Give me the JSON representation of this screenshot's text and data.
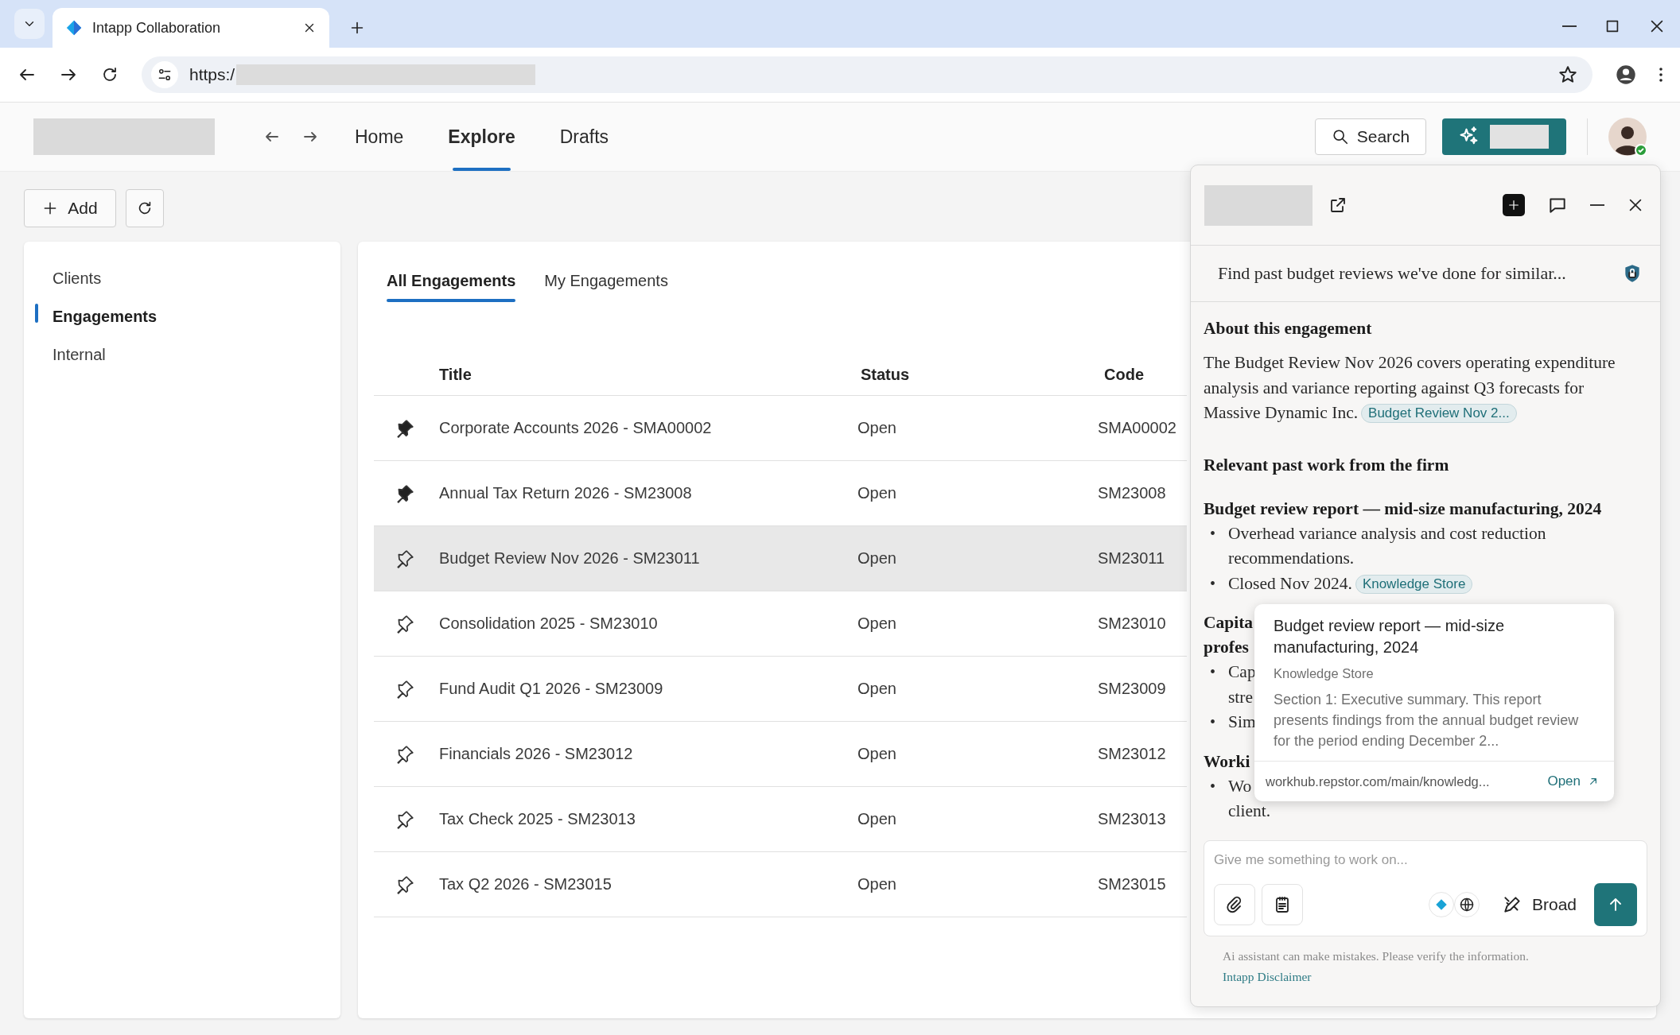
{
  "browser": {
    "tab_title": "Intapp Collaboration",
    "url": "https:/"
  },
  "nav": [
    {
      "label": "Home",
      "selected": false
    },
    {
      "label": "Explore",
      "selected": true
    },
    {
      "label": "Drafts",
      "selected": false
    }
  ],
  "search_label": "Search",
  "add_label": "Add",
  "sidebar": {
    "items": [
      {
        "label": "Clients",
        "selected": false
      },
      {
        "label": "Engagements",
        "selected": true
      },
      {
        "label": "Internal",
        "selected": false
      }
    ]
  },
  "tabs": [
    {
      "label": "All Engagements",
      "selected": true
    },
    {
      "label": "My Engagements",
      "selected": false
    }
  ],
  "table": {
    "columns": [
      "Title",
      "Status",
      "Code"
    ],
    "rows": [
      {
        "title": "Corporate Accounts 2026 - SMA00002",
        "status": "Open",
        "code": "SMA00002",
        "pinned": true,
        "selected": false
      },
      {
        "title": "Annual Tax Return 2026 - SM23008",
        "status": "Open",
        "code": "SM23008",
        "pinned": true,
        "selected": false
      },
      {
        "title": "Budget Review Nov 2026 - SM23011",
        "status": "Open",
        "code": "SM23011",
        "pinned": false,
        "selected": true
      },
      {
        "title": "Consolidation 2025 - SM23010",
        "status": "Open",
        "code": "SM23010",
        "pinned": false,
        "selected": false
      },
      {
        "title": "Fund Audit Q1 2026 - SM23009",
        "status": "Open",
        "code": "SM23009",
        "pinned": false,
        "selected": false
      },
      {
        "title": "Financials 2026 - SM23012",
        "status": "Open",
        "code": "SM23012",
        "pinned": false,
        "selected": false
      },
      {
        "title": "Tax Check 2025 - SM23013",
        "status": "Open",
        "code": "SM23013",
        "pinned": false,
        "selected": false
      },
      {
        "title": "Tax Q2 2026 - SM23015",
        "status": "Open",
        "code": "SM23015",
        "pinned": false,
        "selected": false
      }
    ]
  },
  "assistant": {
    "query": "Find past budget reviews we've done for similar...",
    "content": [
      {
        "kind": "heading",
        "text": "About this engagement"
      },
      {
        "kind": "paragraph",
        "text": "The Budget Review Nov 2026 covers operating expenditure analysis and variance reporting against Q3 forecasts for Massive Dynamic Inc.",
        "chip": "Budget Review Nov 2..."
      },
      {
        "kind": "heading",
        "text": "Relevant past work from the firm"
      },
      {
        "kind": "subheading",
        "text": "Budget review report — mid-size manufacturing, 2024"
      },
      {
        "kind": "bullet",
        "marker": "•",
        "text": "Overhead variance analysis and cost reduction recommendations."
      },
      {
        "kind": "bullet",
        "marker": "•",
        "text": "Closed Nov 2024.",
        "chip": "Knowledge Store"
      },
      {
        "kind": "heading",
        "lines": [
          "Capita",
          "profes"
        ]
      },
      {
        "kind": "bullet",
        "marker": "•",
        "lines": [
          "Cap",
          "stre"
        ]
      },
      {
        "kind": "bullet",
        "marker": "•",
        "lines": [
          "Sim"
        ]
      },
      {
        "kind": "heading",
        "lines": [
          "Worki"
        ]
      },
      {
        "kind": "bullet",
        "marker": "•",
        "lines": [
          "Wo",
          "client."
        ]
      }
    ],
    "popover": {
      "title": "Budget review report — mid-size manufacturing, 2024",
      "source": "Knowledge Store",
      "excerpt": "Section 1: Executive summary. This report presents findings from the annual budget review for the period ending December 2...",
      "url": "workhub.repstor.com/main/knowledg...",
      "open_label": "Open"
    },
    "input": {
      "placeholder": "Give me something to work on...",
      "mode": "Broad"
    },
    "disclaimer": "Ai assistant can make mistakes. Please verify the information.",
    "disclaimer_link": "Intapp Disclaimer"
  }
}
